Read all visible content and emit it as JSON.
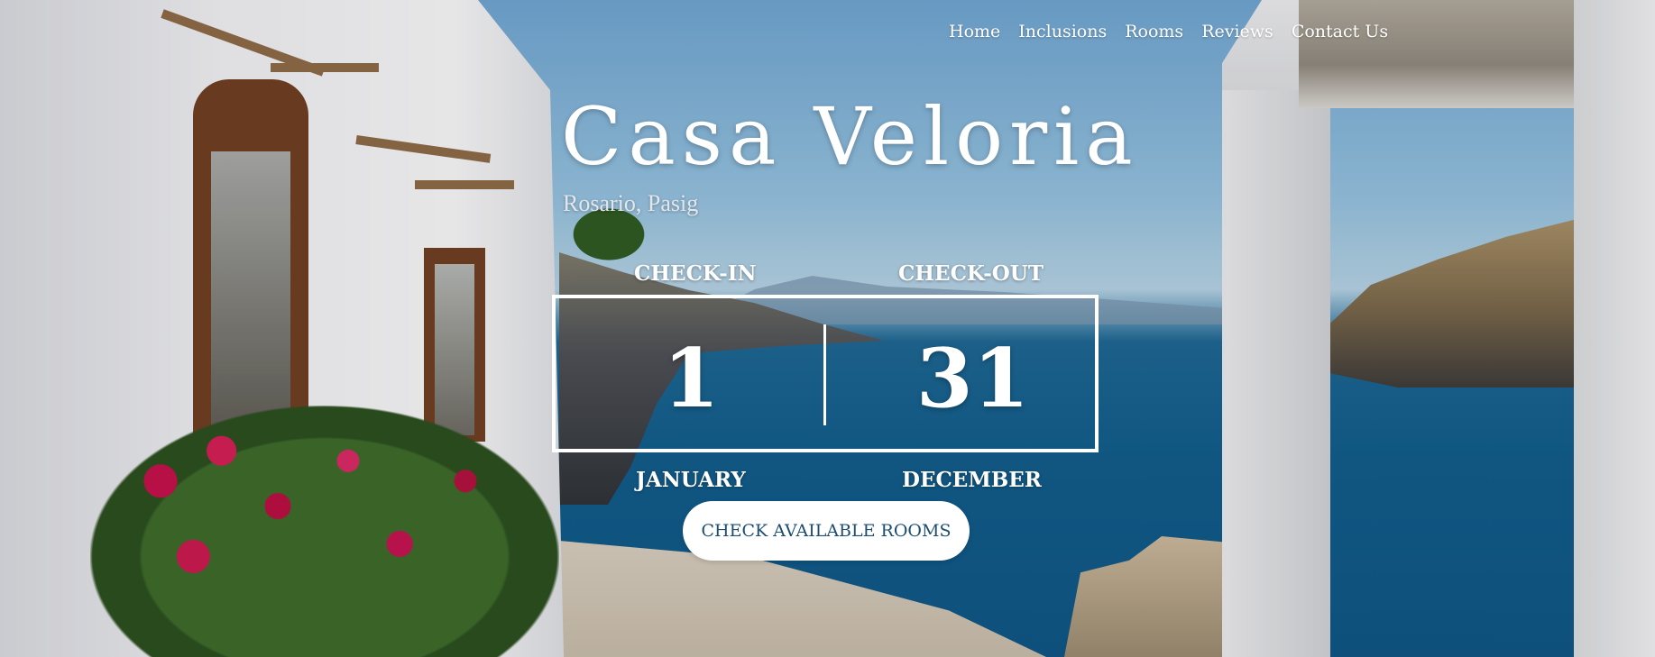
{
  "nav": {
    "items": [
      {
        "label": "Home"
      },
      {
        "label": "Inclusions"
      },
      {
        "label": "Rooms"
      },
      {
        "label": "Reviews"
      },
      {
        "label": "Contact Us"
      }
    ]
  },
  "hero": {
    "title": "Casa Veloria",
    "subtitle": "Rosario, Pasig"
  },
  "booking": {
    "checkin_label": "CHECK-IN",
    "checkout_label": "CHECK-OUT",
    "checkin_day": "1",
    "checkout_day": "31",
    "checkin_month": "JANUARY",
    "checkout_month": "DECEMBER",
    "cta_label": "CHECK AVAILABLE ROOMS"
  },
  "colors": {
    "text": "#ffffff",
    "button_bg": "#ffffff",
    "button_text": "#1d4e72"
  }
}
